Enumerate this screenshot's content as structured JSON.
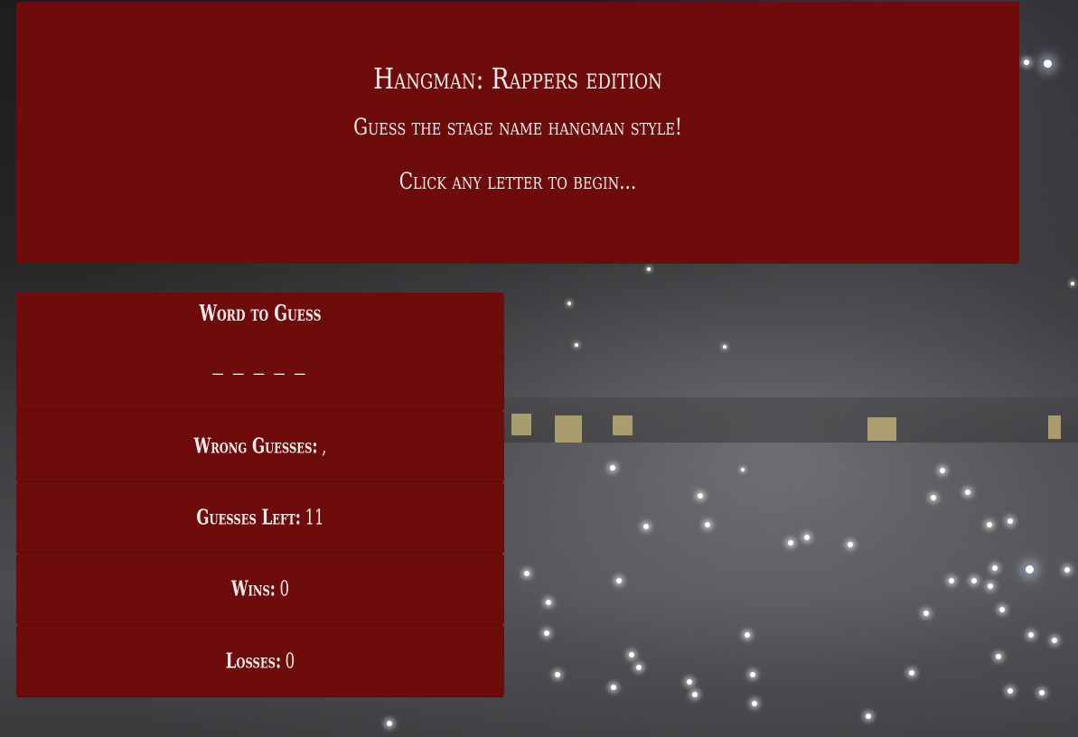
{
  "header": {
    "title": "Hangman: Rappers edition",
    "subtitle": "Guess the stage name hangman style!",
    "prompt": "Click any letter to begin..."
  },
  "game": {
    "word_label": "Word to Guess",
    "word_blanks": "_ _ _ _ _",
    "wrong_label": "Wrong Guesses:",
    "wrong_value": ",",
    "left_label": "Guesses Left:",
    "left_value": "11",
    "wins_label": "Wins:",
    "wins_value": "0",
    "losses_label": "Losses:",
    "losses_value": "0"
  },
  "colors": {
    "panel": "#6e0c0c",
    "text": "#f3ecec"
  },
  "background": {
    "description_icon": "concert-crowd-image"
  }
}
